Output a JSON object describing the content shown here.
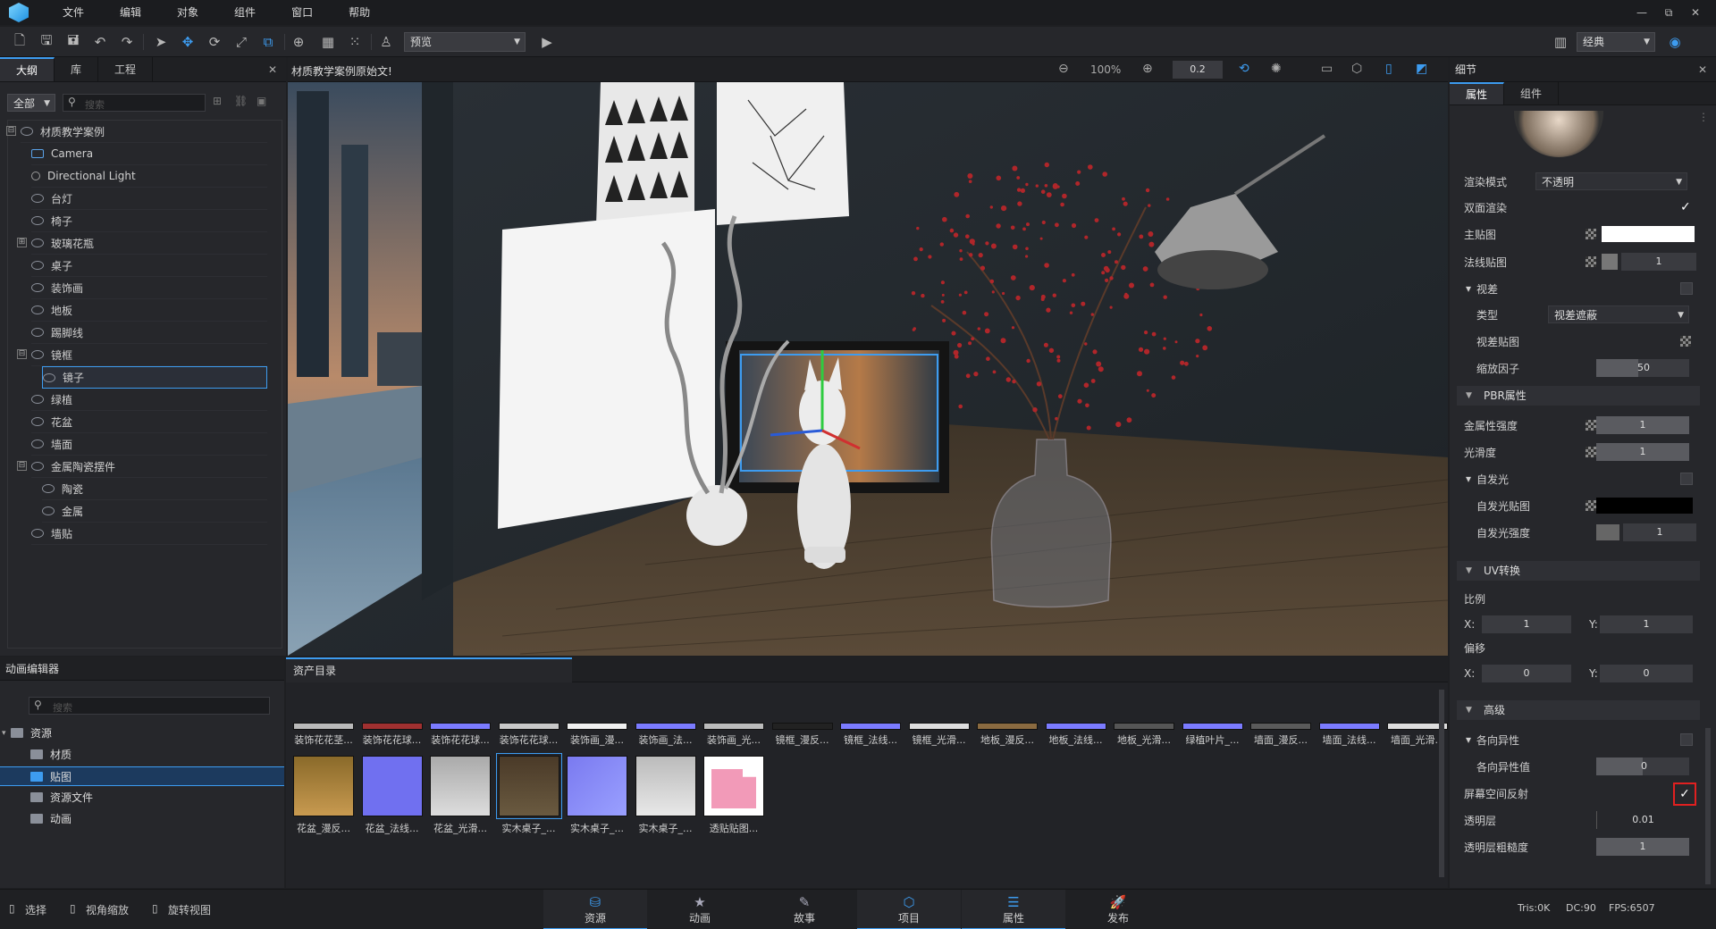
{
  "menubar": {
    "items": [
      "文件",
      "编辑",
      "对象",
      "组件",
      "窗口",
      "帮助"
    ],
    "window_controls": [
      "—",
      "⧉",
      "✕"
    ]
  },
  "toolbar": {
    "preview_mode": "预览",
    "layout_mode": "经典"
  },
  "outline": {
    "tabs": [
      "大纲",
      "库",
      "工程"
    ],
    "filter": "全部",
    "search_placeholder": "搜索",
    "items": [
      {
        "label": "材质教学案例",
        "icon": "object-icon"
      },
      {
        "label": "Camera",
        "icon": "camera-icon"
      },
      {
        "label": "Directional Light",
        "icon": "light-icon"
      },
      {
        "label": "台灯",
        "icon": "object-icon"
      },
      {
        "label": "椅子",
        "icon": "object-icon"
      },
      {
        "label": "玻璃花瓶",
        "icon": "object-icon"
      },
      {
        "label": "桌子",
        "icon": "object-icon"
      },
      {
        "label": "装饰画",
        "icon": "object-icon"
      },
      {
        "label": "地板",
        "icon": "object-icon"
      },
      {
        "label": "踢脚线",
        "icon": "object-icon"
      },
      {
        "label": "镜框",
        "icon": "object-icon"
      },
      {
        "label": "镜子",
        "icon": "object-icon"
      },
      {
        "label": "绿植",
        "icon": "object-icon"
      },
      {
        "label": "花盆",
        "icon": "object-icon"
      },
      {
        "label": "墙面",
        "icon": "object-icon"
      },
      {
        "label": "金属陶瓷摆件",
        "icon": "object-icon"
      },
      {
        "label": "陶瓷",
        "icon": "object-icon"
      },
      {
        "label": "金属",
        "icon": "object-icon"
      },
      {
        "label": "墙贴",
        "icon": "object-icon"
      }
    ]
  },
  "viewport": {
    "title": "材质教学案例原始文!",
    "zoom": "100%",
    "speed": "0.2"
  },
  "details": {
    "title": "细节",
    "tabs": [
      "属性",
      "组件"
    ],
    "render_mode_label": "渲染模式",
    "render_mode_value": "不透明",
    "double_side_label": "双面渲染",
    "main_map_label": "主贴图",
    "normal_map_label": "法线贴图",
    "normal_map_value": "1",
    "parallax_label": "视差",
    "parallax_type_label": "类型",
    "parallax_type_value": "视差遮蔽",
    "parallax_map_label": "视差贴图",
    "scale_factor_label": "缩放因子",
    "scale_factor_value": "50",
    "pbr_label": "PBR属性",
    "metal_label": "金属性强度",
    "metal_value": "1",
    "smooth_label": "光滑度",
    "smooth_value": "1",
    "emission_label": "自发光",
    "emission_map_label": "自发光贴图",
    "emission_strength_label": "自发光强度",
    "emission_strength_value": "1",
    "uv_label": "UV转换",
    "scale_label": "比例",
    "scale_x": "1",
    "scale_y": "1",
    "offset_label": "偏移",
    "offset_x": "0",
    "offset_y": "0",
    "x_label": "X:",
    "y_label": "Y:",
    "advanced_label": "高级",
    "aniso_label": "各向异性",
    "aniso_value_label": "各向异性值",
    "aniso_value": "0",
    "ssr_label": "屏幕空间反射",
    "clearcoat_label": "透明层",
    "clearcoat_value": "0.01",
    "clearcoat_rough_label": "透明层粗糙度",
    "clearcoat_rough_value": "1"
  },
  "animation": {
    "title": "动画编辑器",
    "search_placeholder": "搜索"
  },
  "assets": {
    "tab": "资产目录",
    "folders": [
      {
        "label": "资源",
        "level": 0
      },
      {
        "label": "材质",
        "level": 1
      },
      {
        "label": "贴图",
        "level": 1,
        "selected": true
      },
      {
        "label": "资源文件",
        "level": 1
      },
      {
        "label": "动画",
        "level": 1
      }
    ],
    "row1": [
      "装饰花花茎...",
      "装饰花花球...",
      "装饰花花球...",
      "装饰花花球...",
      "装饰画_漫...",
      "装饰画_法...",
      "装饰画_光...",
      "镜框_漫反...",
      "镜框_法线...",
      "镜框_光滑...",
      "地板_漫反...",
      "地板_法线...",
      "地板_光滑...",
      "绿植叶片_...",
      "墙面_漫反...",
      "墙面_法线...",
      "墙面_光滑..."
    ],
    "row2": [
      "花盆_漫反...",
      "花盆_法线...",
      "花盆_光滑...",
      "实木桌子_...",
      "实木桌子_...",
      "实木桌子_...",
      "透贴贴图..."
    ]
  },
  "bottombar": {
    "tools": [
      "选择",
      "视角缩放",
      "旋转视图"
    ],
    "tabs": [
      "资源",
      "动画",
      "故事",
      "项目",
      "属性",
      "发布"
    ],
    "stats": {
      "tris": "Tris:0K",
      "dc": "DC:90",
      "fps": "FPS:6507"
    }
  },
  "colors": {
    "accent": "#3d9cf0",
    "highlight": "#e02020"
  }
}
